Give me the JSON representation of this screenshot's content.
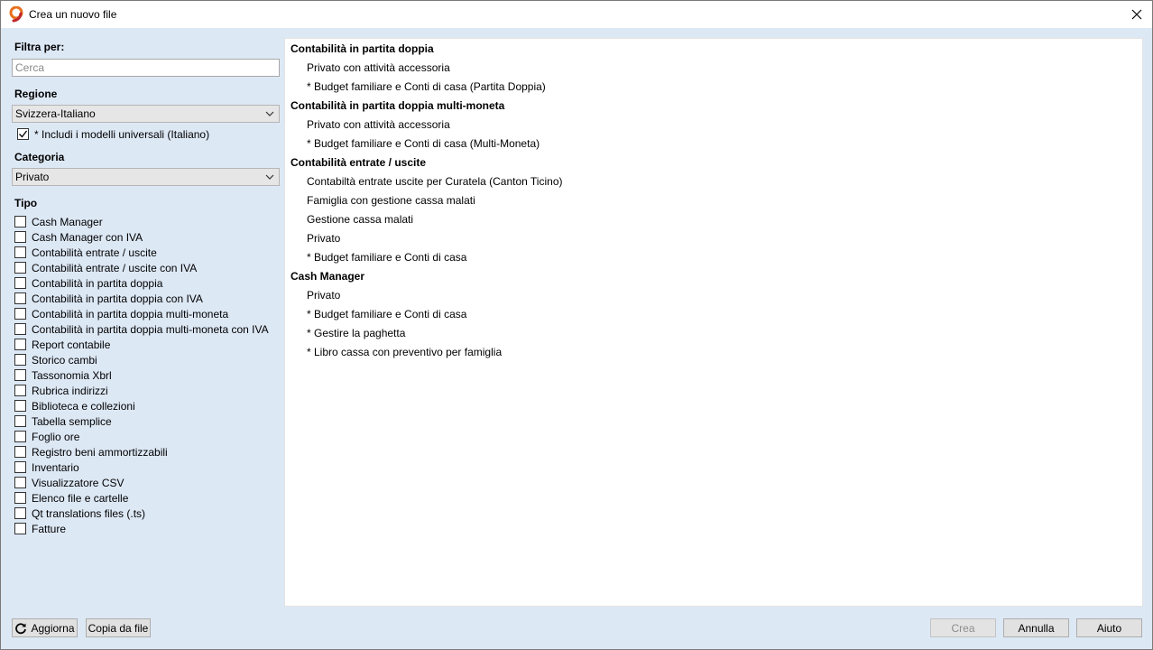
{
  "window": {
    "title": "Crea un nuovo file"
  },
  "filter": {
    "label": "Filtra per:",
    "search_placeholder": "Cerca"
  },
  "region": {
    "label": "Regione",
    "selected": "Svizzera-Italiano",
    "include_universal_label": "* Includi i modelli universali (Italiano)",
    "include_universal_checked": true
  },
  "category": {
    "label": "Categoria",
    "selected": "Privato"
  },
  "type": {
    "label": "Tipo",
    "items": [
      "Cash Manager",
      "Cash Manager con IVA",
      "Contabilità entrate / uscite",
      "Contabilità entrate / uscite con IVA",
      "Contabilità in partita doppia",
      "Contabilità in partita doppia con IVA",
      "Contabilità in partita doppia multi-moneta",
      "Contabilità in partita doppia multi-moneta con IVA",
      "Report contabile",
      "Storico cambi",
      "Tassonomia Xbrl",
      "Rubrica indirizzi",
      "Biblioteca e collezioni",
      "Tabella semplice",
      "Foglio ore",
      "Registro beni ammortizzabili",
      "Inventario",
      "Visualizzatore CSV",
      "Elenco file e cartelle",
      "Qt translations files (.ts)",
      "Fatture"
    ]
  },
  "templates": {
    "groups": [
      {
        "title": "Contabilità in partita doppia",
        "items": [
          "Privato con attività accessoria",
          "* Budget familiare e Conti di casa (Partita Doppia)"
        ]
      },
      {
        "title": "Contabilità in partita doppia multi-moneta",
        "items": [
          "Privato con attività accessoria",
          "* Budget familiare e Conti di casa (Multi-Moneta)"
        ]
      },
      {
        "title": "Contabilità entrate / uscite",
        "items": [
          "Contabiltà entrate uscite per Curatela (Canton Ticino)",
          "Famiglia con gestione cassa malati",
          "Gestione cassa malati",
          "Privato",
          "* Budget familiare e Conti di casa"
        ]
      },
      {
        "title": "Cash Manager",
        "items": [
          "Privato",
          "* Budget familiare e Conti di casa",
          "* Gestire la paghetta",
          "* Libro cassa con preventivo per famiglia"
        ]
      }
    ]
  },
  "buttons": {
    "refresh": "Aggiorna",
    "copy_from_file": "Copia da file",
    "create": "Crea",
    "cancel": "Annulla",
    "help": "Aiuto"
  }
}
